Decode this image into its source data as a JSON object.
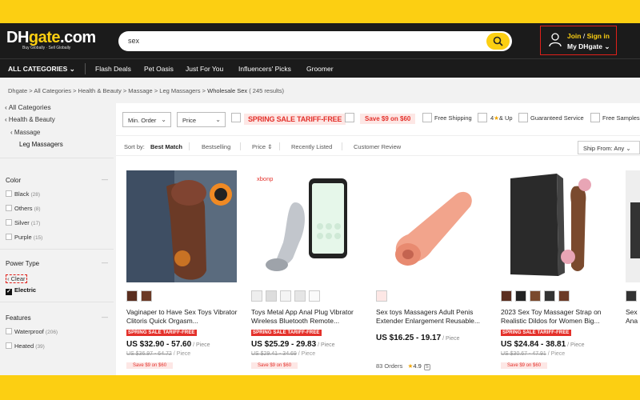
{
  "header": {
    "logo_main": "DH",
    "logo_accent": "gate",
    "logo_suffix": ".com",
    "logo_tagline": "Buy Globally · Sell Globally",
    "search_query": "sex",
    "join": "Join",
    "sep": " / ",
    "signin": "Sign in",
    "my_account": "My DHgate",
    "icons": {
      "search": "search-icon",
      "user": "user-icon"
    }
  },
  "nav": {
    "all_categories": "ALL CATEGORIES",
    "items": [
      "Flash Deals",
      "Pet Oasis",
      "Just For You",
      "Influencers' Picks",
      "Groomer"
    ]
  },
  "breadcrumb": {
    "path": "Dhgate > All Categories > Health & Beauty > Massage > Leg Massagers > ",
    "current": "Wholesale Sex",
    "count": " ( 245  results)"
  },
  "sidebar": {
    "all_categories": "All Categories",
    "health_beauty": "Health & Beauty",
    "massage": "Massage",
    "leg_massagers": "Leg Massagers",
    "color_title": "Color",
    "colors": [
      {
        "name": "Black",
        "count": "(28)"
      },
      {
        "name": "Others",
        "count": "(8)"
      },
      {
        "name": "Silver",
        "count": "(17)"
      },
      {
        "name": "Purple",
        "count": "(15)"
      }
    ],
    "power_title": "Power Type",
    "clear": "Clear",
    "electric": "Electric",
    "features_title": "Features",
    "features": [
      {
        "name": "Waterproof",
        "count": "(206)"
      },
      {
        "name": "Heated",
        "count": "(39)"
      }
    ],
    "dash": "—"
  },
  "filters": {
    "min_order": "Min. Order",
    "price": "Price",
    "promo_tariff": "SPRING SALE TARIFF-FREE",
    "promo_save": "Save $9 on $60",
    "free_shipping": "Free Shipping",
    "four_up": "4",
    "four_up_star": "★",
    "four_up_suffix": "& Up",
    "guaranteed": "Guaranteed Service",
    "free_samples": "Free Samples"
  },
  "sort": {
    "sort_by": "Sort by:",
    "best_match": "Best Match",
    "bestselling": "Bestselling",
    "price": "Price",
    "price_icon": "⇕",
    "recently_listed": "Recently Listed",
    "customer_review": "Customer Review",
    "ship_from": "Ship From:",
    "ship_value": "Any"
  },
  "products": [
    {
      "title": "Vaginaper to Have Sex Toys Vibrator Clitoris Quick Orgasm...",
      "badge": "SPRING SALE TARIFF-FREE",
      "price": "US $32.90 - 57.60",
      "unit": " / Piece",
      "orig": "US $36.97 - 64.72",
      "orig_unit": " / Piece",
      "save": "Save $9 on $60"
    },
    {
      "brand": "xbonp",
      "title": "Toys Metal App Anal Plug Vibrator Wireless Bluetooth Remote...",
      "badge": "SPRING SALE TARIFF-FREE",
      "price": "US $25.29 - 29.83",
      "unit": " / Piece",
      "orig": "US $29.41 - 34.69",
      "orig_unit": " / Piece",
      "save": "Save $9 on $60"
    },
    {
      "title": "Sex toys Massagers Adult Penis Extender Enlargement Reusable...",
      "price": "US $16.25 - 19.17",
      "unit": " / Piece",
      "orders": "83 Orders",
      "rating_star": "★",
      "rating": "4.9",
      "sbadge": "S"
    },
    {
      "title": "2023 Sex Toy Massager Strap on Realistic Dildos for Women Big...",
      "badge": "SPRING SALE TARIFF-FREE",
      "price": "US $24.84 - 38.81",
      "unit": " / Piece",
      "orig": "US $30.67 - 47.91",
      "orig_unit": " / Piece",
      "save": "Save $9 on $60"
    },
    {
      "title_a": "Sex",
      "title_b": "Ana"
    }
  ],
  "colors": {
    "accent": "#fccf12",
    "header_bg": "#1b1b1b",
    "promo_red": "#e4312b"
  }
}
